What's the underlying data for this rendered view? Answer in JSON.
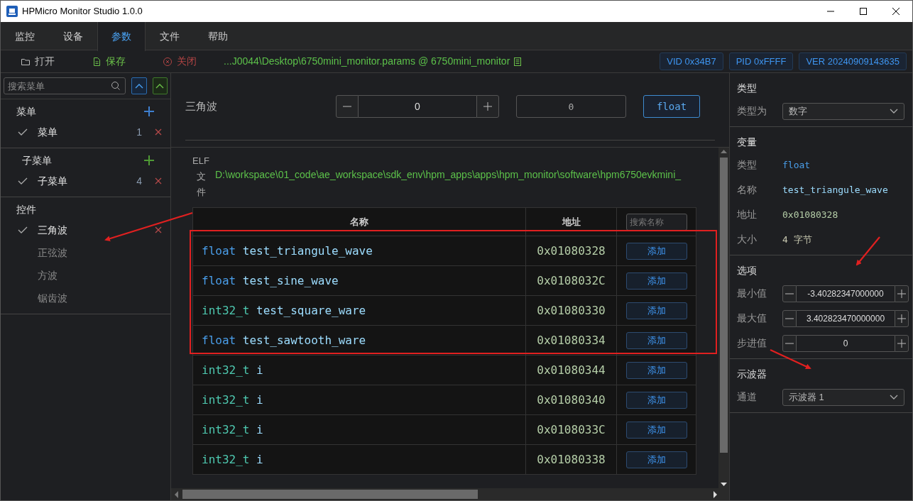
{
  "window": {
    "title": "HPMicro Monitor Studio 1.0.0"
  },
  "tabs": [
    {
      "label": "监控",
      "selected": false
    },
    {
      "label": "设备",
      "selected": false
    },
    {
      "label": "参数",
      "selected": true
    },
    {
      "label": "文件",
      "selected": false
    },
    {
      "label": "帮助",
      "selected": false
    }
  ],
  "toolbar": {
    "actions": [
      {
        "label": "打开",
        "kind": "open"
      },
      {
        "label": "保存",
        "kind": "save"
      },
      {
        "label": "关闭",
        "kind": "close"
      }
    ],
    "file_path": "...J0044\\Desktop\\6750mini_monitor.params @ 6750mini_monitor",
    "badges": [
      "VID 0x34B7",
      "PID 0xFFFF",
      "VER 20240909143635"
    ]
  },
  "sidebar": {
    "search": {
      "placeholder": "搜索菜单"
    },
    "sections": [
      {
        "title": "菜单",
        "kind": "menu",
        "items": [
          {
            "label": "菜单",
            "checked": true,
            "count": "1",
            "removable": true
          }
        ]
      },
      {
        "title": "子菜单",
        "kind": "submenu",
        "items": [
          {
            "label": "子菜单",
            "checked": true,
            "count": "4",
            "removable": true
          }
        ]
      },
      {
        "title": "控件",
        "kind": "control",
        "items": [
          {
            "label": "三角波",
            "checked": true,
            "removable": true
          },
          {
            "label": "正弦波",
            "checked": false,
            "removable": false
          },
          {
            "label": "方波",
            "checked": false,
            "removable": false
          },
          {
            "label": "锯齿波",
            "checked": false,
            "removable": false
          }
        ]
      }
    ]
  },
  "control": {
    "label": "三角波",
    "stepper_value": "0",
    "display_value": "0",
    "type_button": "float"
  },
  "elf": {
    "label": "ELF 文件",
    "path": "D:\\workspace\\01_code\\ae_workspace\\sdk_env\\hpm_apps\\apps\\hpm_monitor\\software\\hpm6750evkmini_"
  },
  "table": {
    "columns": [
      "名称",
      "地址"
    ],
    "search": {
      "placeholder": "搜索名称"
    },
    "rows": [
      {
        "type": "float",
        "color": "#4a9eea",
        "name": "test_triangule_wave",
        "address": "0x01080328",
        "button": "添加"
      },
      {
        "type": "float",
        "color": "#4a9eea",
        "name": "test_sine_wave",
        "address": "0x0108032C",
        "button": "添加"
      },
      {
        "type": "int32_t",
        "color": "#4ec9b0",
        "name": "test_square_ware",
        "address": "0x01080330",
        "button": "添加"
      },
      {
        "type": "float",
        "color": "#4a9eea",
        "name": "test_sawtooth_ware",
        "address": "0x01080334",
        "button": "添加"
      },
      {
        "type": "int32_t",
        "color": "#4ec9b0",
        "name": "i",
        "address": "0x01080344",
        "button": "添加"
      },
      {
        "type": "int32_t",
        "color": "#4ec9b0",
        "name": "i",
        "address": "0x01080340",
        "button": "添加"
      },
      {
        "type": "int32_t",
        "color": "#4ec9b0",
        "name": "i",
        "address": "0x0108033C",
        "button": "添加"
      },
      {
        "type": "int32_t",
        "color": "#4ec9b0",
        "name": "i",
        "address": "0x01080338",
        "button": "添加"
      }
    ]
  },
  "inspector": {
    "sections": [
      {
        "title": "类型",
        "fields": [
          {
            "label": "类型为",
            "kind": "select",
            "value": "数字"
          }
        ]
      },
      {
        "title": "变量",
        "fields": [
          {
            "label": "类型",
            "kind": "info",
            "value": "float",
            "color": "#4a9eea"
          },
          {
            "label": "名称",
            "kind": "info",
            "value": "test_triangule_wave",
            "color": "#9cdcfe"
          },
          {
            "label": "地址",
            "kind": "info",
            "value": "0x01080328",
            "color": "#b5cea8"
          },
          {
            "label": "大小",
            "kind": "info",
            "value": "4 字节",
            "color": "#c8c8b0"
          }
        ]
      },
      {
        "title": "选项",
        "fields": [
          {
            "label": "最小值",
            "kind": "stepper",
            "value": "-3.40282347000000"
          },
          {
            "label": "最大值",
            "kind": "stepper",
            "value": "3.402823470000000"
          },
          {
            "label": "步进值",
            "kind": "stepper",
            "value": "0"
          }
        ]
      },
      {
        "title": "示波器",
        "fields": [
          {
            "label": "通道",
            "kind": "select",
            "value": "示波器 1"
          }
        ]
      }
    ]
  }
}
